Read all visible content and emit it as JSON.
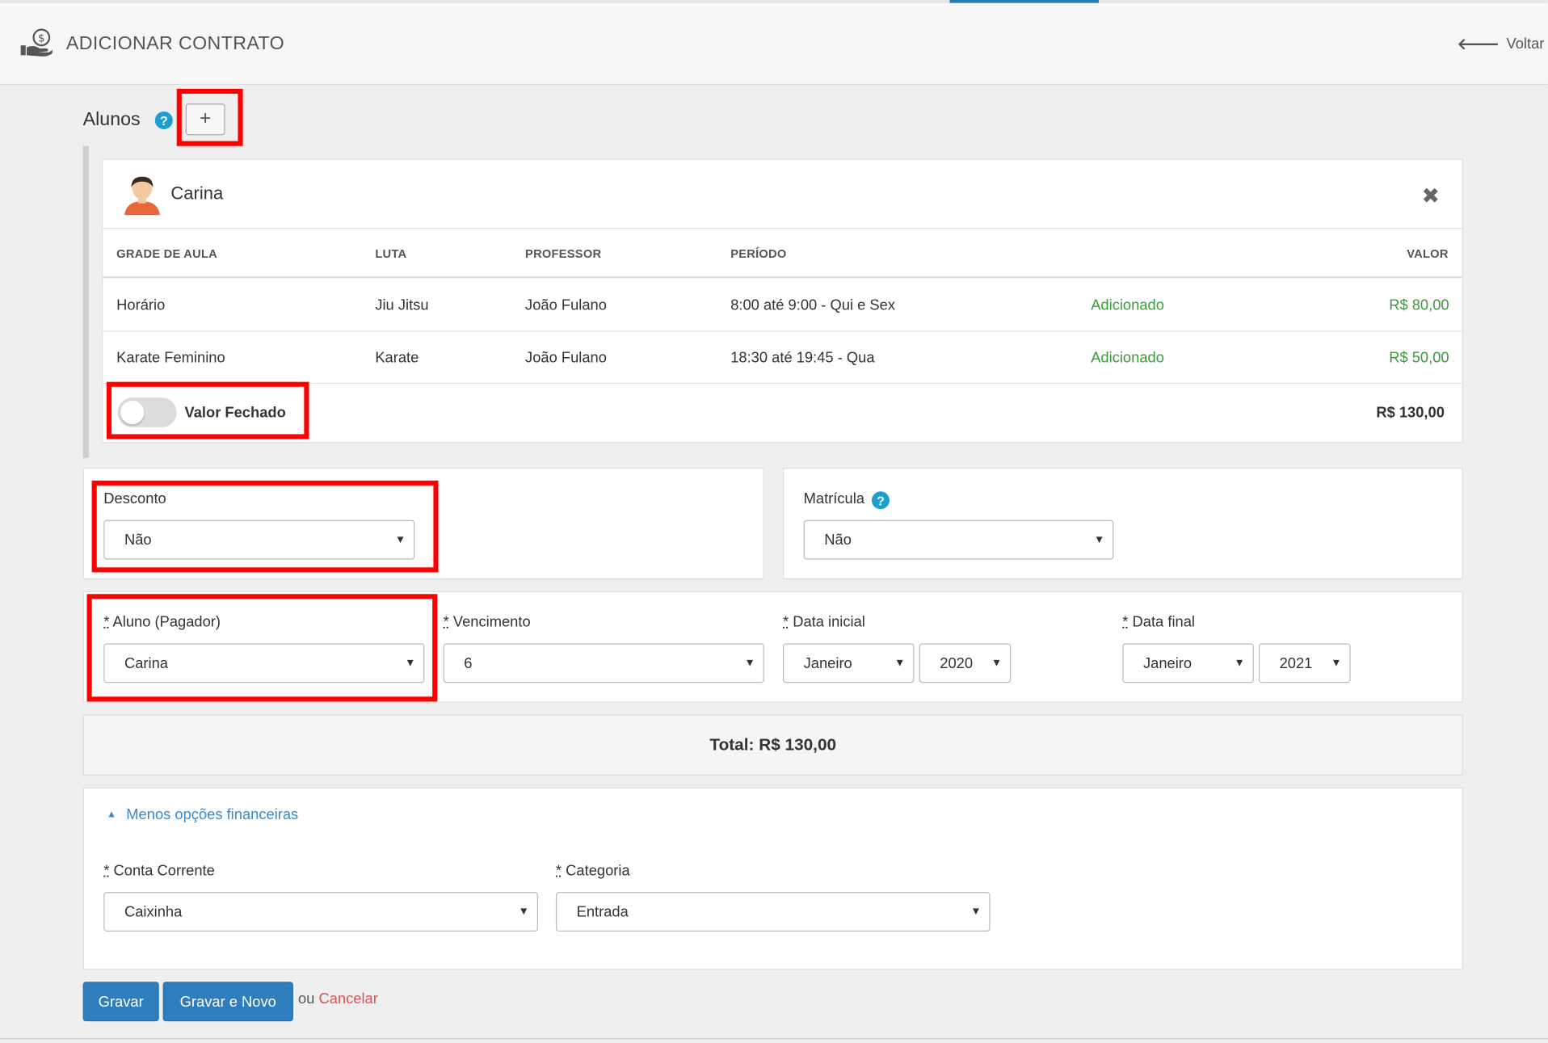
{
  "header": {
    "title": "ADICIONAR CONTRATO",
    "back_label": "Voltar"
  },
  "alunos": {
    "label": "Alunos",
    "help": "?",
    "add_label": "+"
  },
  "student": {
    "name": "Carina",
    "close": "✖",
    "columns": [
      "GRADE DE AULA",
      "LUTA",
      "PROFESSOR",
      "PERÍODO",
      "VALOR"
    ],
    "rows": [
      {
        "grade": "Horário",
        "luta": "Jiu Jitsu",
        "professor": "João Fulano",
        "periodo": "8:00 até 9:00 - Qui e Sex",
        "status": "Adicionado",
        "valor": "R$ 80,00"
      },
      {
        "grade": "Karate Feminino",
        "luta": "Karate",
        "professor": "João Fulano",
        "periodo": "18:30 até 19:45 - Qua",
        "status": "Adicionado",
        "valor": "R$ 50,00"
      }
    ],
    "toggle_label": "Valor Fechado",
    "toggle_on": false,
    "total": "R$ 130,00"
  },
  "desconto": {
    "label": "Desconto",
    "value": "Não"
  },
  "matricula": {
    "label": "Matrícula",
    "help": "?",
    "value": "Não"
  },
  "pagador": {
    "req": "*",
    "label": "Aluno (Pagador)",
    "value": "Carina"
  },
  "vencimento": {
    "req": "*",
    "label": "Vencimento",
    "value": "6"
  },
  "data_inicial": {
    "req": "*",
    "label": "Data inicial",
    "month": "Janeiro",
    "year": "2020"
  },
  "data_final": {
    "req": "*",
    "label": "Data final",
    "month": "Janeiro",
    "year": "2021"
  },
  "total_text": "Total: R$ 130,00",
  "financeiro": {
    "toggle_label": "Menos opções financeiras",
    "conta": {
      "req": "*",
      "label": "Conta Corrente",
      "value": "Caixinha"
    },
    "categoria": {
      "req": "*",
      "label": "Categoria",
      "value": "Entrada"
    }
  },
  "actions": {
    "save": "Gravar",
    "save_new": "Gravar e Novo",
    "or": "ou",
    "cancel": "Cancelar"
  },
  "colors": {
    "accent": "#2e7dbc",
    "success": "#3c9a3c",
    "danger": "#d9534f",
    "highlight": "#ff0000"
  }
}
